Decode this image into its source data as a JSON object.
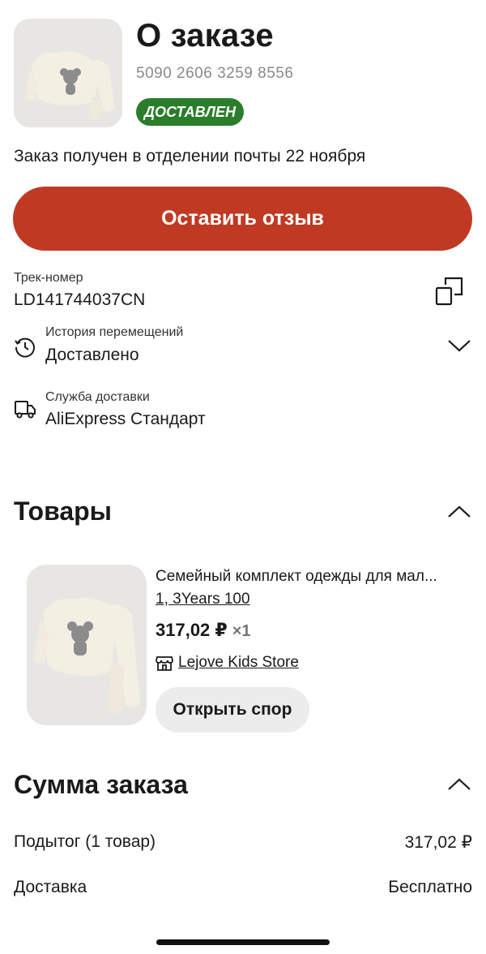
{
  "header": {
    "title": "О заказе",
    "order_number": "5090 2606 3259 8556",
    "status": "ДОСТАВЛЕН",
    "status_color": "#2b7d2b",
    "delivery_note": "Заказ получен в отделении почты 22 ноября"
  },
  "actions": {
    "review_label": "Оставить отзыв",
    "accent_color": "#c03a23"
  },
  "tracking": {
    "label": "Трек-номер",
    "number": "LD141744037CN",
    "copy_icon": "copy-icon"
  },
  "history": {
    "label": "История перемещений",
    "value": "Доставлено",
    "icon": "history-clock-icon"
  },
  "shipping": {
    "label": "Служба доставки",
    "value": "AliExpress Стандарт",
    "icon": "truck-icon"
  },
  "items_section": {
    "title": "Товары",
    "items": [
      {
        "title": "Семейный комплект одежды для мал...",
        "variant": "1, 3Years 100",
        "price": "317,02 ₽",
        "quantity": "×1",
        "store": "Lejove Kids Store",
        "dispute_label": "Открыть спор"
      }
    ]
  },
  "summary": {
    "title": "Сумма заказа",
    "rows": [
      {
        "label": "Подытог (1 товар)",
        "value": "317,02 ₽"
      },
      {
        "label": "Доставка",
        "value": "Бесплатно"
      }
    ]
  }
}
